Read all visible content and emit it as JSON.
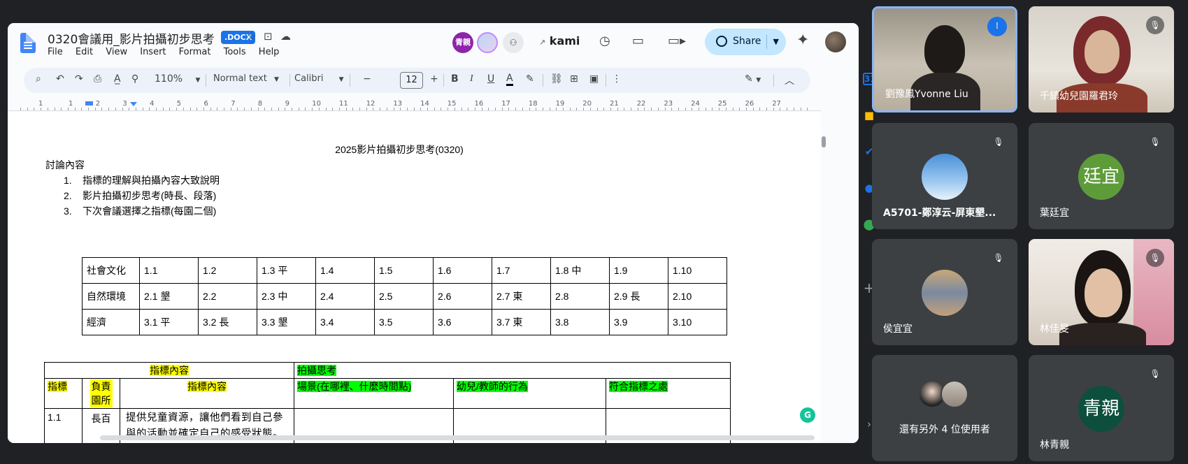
{
  "docs": {
    "title": "0320會議用_影片拍攝初步思考",
    "badge": ".DOCX",
    "menu": [
      "File",
      "Edit",
      "View",
      "Insert",
      "Format",
      "Tools",
      "Help"
    ],
    "collab_avatar_label": "青親",
    "kami": "kami",
    "share_label": "Share",
    "toolbar": {
      "zoom": "110%",
      "style": "Normal text",
      "font": "Calibri",
      "size": "12"
    },
    "ruler_ticks": [
      "1",
      "1",
      "2",
      "3",
      "4",
      "5",
      "6",
      "7",
      "8",
      "9",
      "10",
      "11",
      "12",
      "13",
      "14",
      "15",
      "16",
      "17",
      "18",
      "19",
      "20",
      "21",
      "22",
      "23",
      "24",
      "25",
      "26",
      "27"
    ]
  },
  "document": {
    "title": "2025影片拍攝初步思考(0320)",
    "discussion_heading": "討論內容",
    "list": [
      {
        "num": "1.",
        "text": "指標的理解與拍攝內容大致說明"
      },
      {
        "num": "2.",
        "text": "影片拍攝初步思考(時長、段落)"
      },
      {
        "num": "3.",
        "text": "下次會議選擇之指標(每園二個)"
      }
    ],
    "indicator_table": [
      [
        "社會文化",
        "1.1",
        "1.2",
        "1.3 平",
        "1.4",
        "1.5",
        "1.6",
        "1.7",
        "1.8 中",
        "1.9",
        "1.10"
      ],
      [
        "自然環境",
        "2.1 墾",
        "2.2",
        "2.3 中",
        "2.4",
        "2.5",
        "2.6",
        "2.7 東",
        "2.8",
        "2.9 長",
        "2.10"
      ],
      [
        "經濟",
        "3.1 平",
        "3.2 長",
        "3.3 墾",
        "3.4",
        "3.5",
        "3.6",
        "3.7 東",
        "3.8",
        "3.9",
        "3.10"
      ]
    ],
    "plan_table": {
      "group1": "指標內容",
      "group2": "拍攝思考",
      "col_indicator": "指標",
      "col_owner": "負責園所",
      "col_content": "指標內容",
      "col_scene": "場景(在哪裡、什麼時間點)",
      "col_action": "幼兒/教師的行為",
      "col_fit": "符合指標之處",
      "row1": {
        "id": "1.1",
        "owner": "長百",
        "content": "提供兒童資源，讓他們看到自己參與的活動並確定自己的感受狀態。（鏡子、相機等，促進兒童的自我認同和對他兒社"
      }
    }
  },
  "meet": {
    "tiles": [
      {
        "name": "劉豫鳳Yvonne Liu"
      },
      {
        "name": "千鎮幼兒園羅君玲"
      },
      {
        "name": "A5701-鄭淳云-屏東墾..."
      },
      {
        "name": "葉廷宜",
        "initials": "廷宜"
      },
      {
        "name": "侯宜宜"
      },
      {
        "name": "林佳旻"
      },
      {
        "name": "還有另外 4 位使用者"
      },
      {
        "name": "林青親",
        "initials": "青親"
      }
    ]
  },
  "colors": {
    "highlight_yellow": "#ffff00",
    "highlight_green": "#00ff00",
    "share_bg": "#c2e7ff",
    "meet_tile": "#3c4043",
    "active_border": "#8ab4f8"
  }
}
